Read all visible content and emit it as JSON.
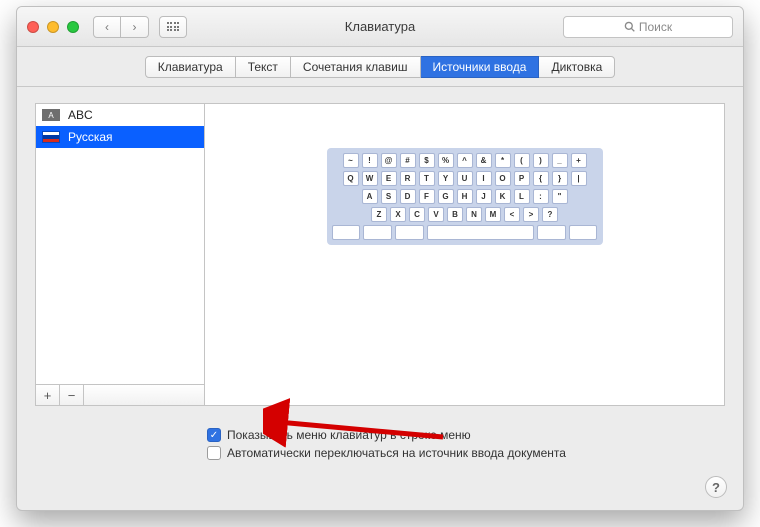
{
  "window": {
    "title": "Клавиатура"
  },
  "toolbar": {
    "back_icon": "‹",
    "forward_icon": "›",
    "search_placeholder": "Поиск"
  },
  "tabs": [
    {
      "label": "Клавиатура"
    },
    {
      "label": "Текст"
    },
    {
      "label": "Сочетания клавиш"
    },
    {
      "label": "Источники ввода",
      "active": true
    },
    {
      "label": "Диктовка"
    }
  ],
  "sources": [
    {
      "label": "ABC",
      "flag_letter": "A"
    },
    {
      "label": "Русская",
      "selected": true
    }
  ],
  "addremove": {
    "plus": "+",
    "minus": "−"
  },
  "keyboard": {
    "row1": [
      "~",
      "!",
      "@",
      "#",
      "$",
      "%",
      "^",
      "&",
      "*",
      "(",
      ")",
      "_",
      "+"
    ],
    "row2": [
      "Q",
      "W",
      "E",
      "R",
      "T",
      "Y",
      "U",
      "I",
      "O",
      "P",
      "{",
      "}",
      "|"
    ],
    "row3": [
      "A",
      "S",
      "D",
      "F",
      "G",
      "H",
      "J",
      "K",
      "L",
      ":",
      "\""
    ],
    "row4": [
      "Z",
      "X",
      "C",
      "V",
      "B",
      "N",
      "M",
      "<",
      ">",
      "?"
    ]
  },
  "checks": {
    "show_menu": {
      "checked": true,
      "label": "Показывать меню клавиатур в строке меню"
    },
    "auto_switch": {
      "checked": false,
      "label": "Автоматически переключаться на источник ввода документа"
    }
  },
  "help": {
    "label": "?"
  }
}
